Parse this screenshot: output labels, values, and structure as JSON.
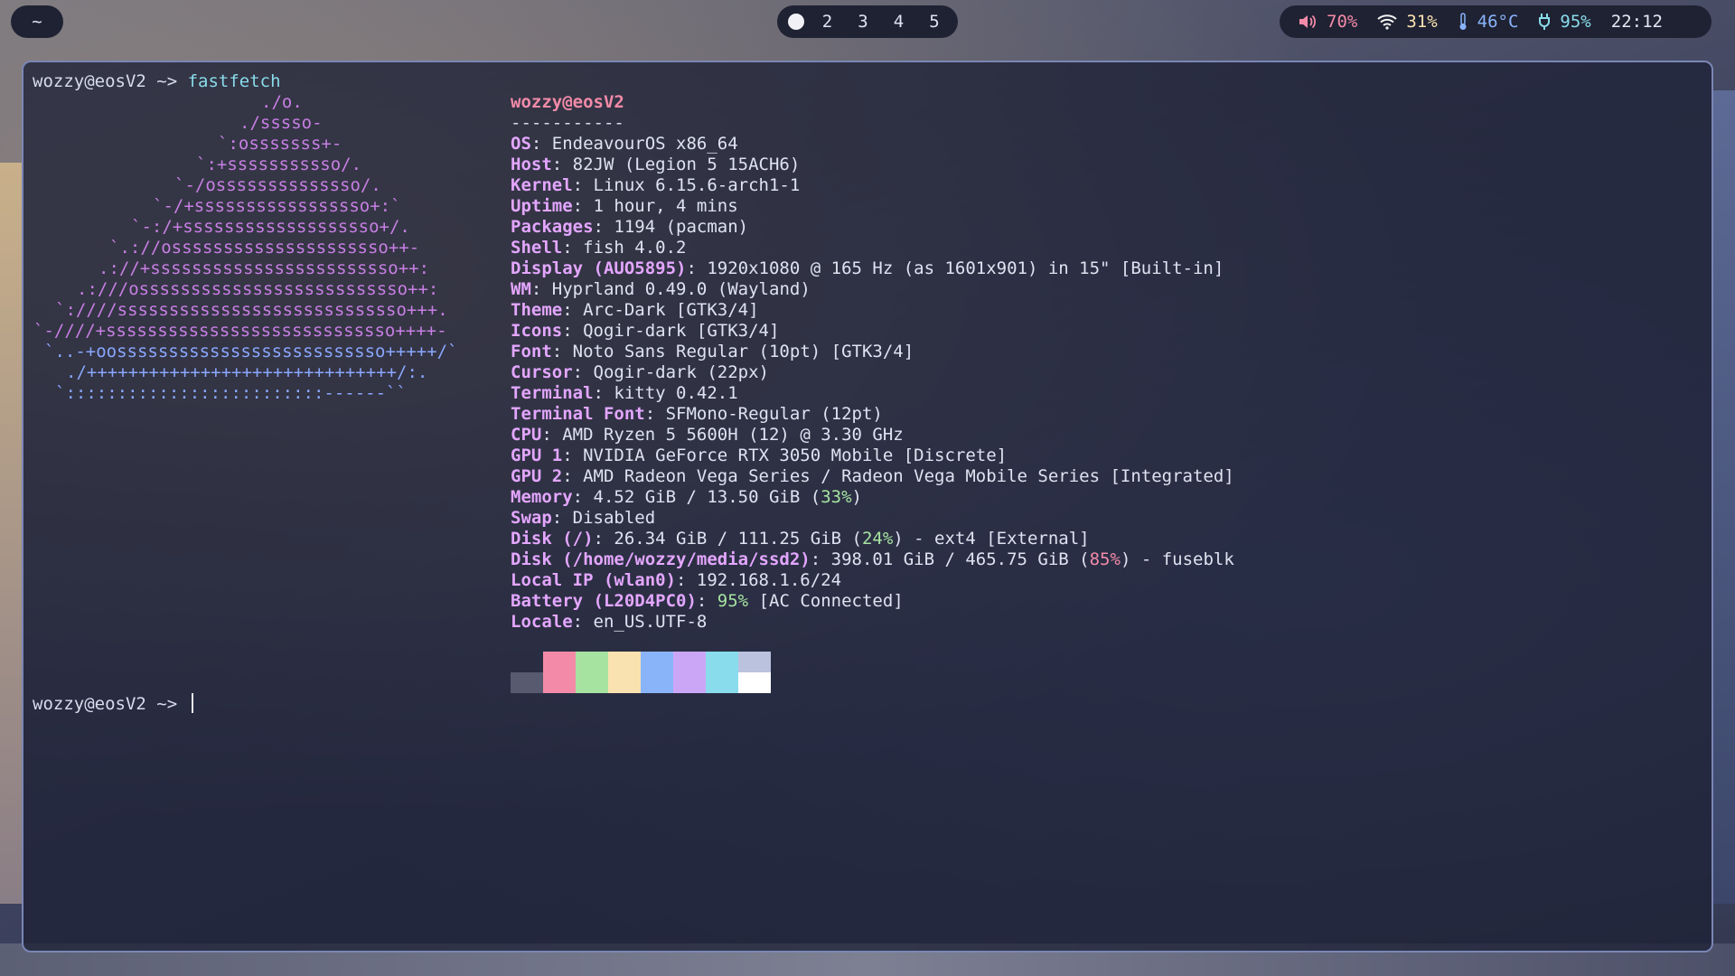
{
  "topbar": {
    "left_label": "~",
    "workspaces": [
      "2",
      "3",
      "4",
      "5"
    ],
    "volume": "70%",
    "wifi": "31%",
    "temperature": "46°C",
    "battery": "95%",
    "clock": "22:12",
    "icons": [
      "speaker-icon",
      "wifi-icon",
      "thermometer-icon",
      "power-plug-icon"
    ]
  },
  "terminal": {
    "prompt": "wozzy@eosV2 ~> ",
    "command": "fastfetch",
    "title_user": "wozzy",
    "title_host": "@eosV2",
    "separator": "-----------",
    "logo_lines": [
      "./o.",
      "./sssso-",
      "`:osssssss+-",
      "`:+sssssssssso/.",
      "`-/ossssssssssssso/.",
      "`-/+sssssssssssssssso+:`",
      "`-:/+sssssssssssssssssso+/.",
      "`.://osssssssssssssssssssso++-",
      ".://+ssssssssssssssssssssssso++:",
      ".:///ossssssssssssssssssssssssso++:",
      "`:////ssssssssssssssssssssssssssso+++.",
      "`-////+ssssssssssssssssssssssssssso++++-",
      "`..-+oossssssssssssssssssssssssso+++++/`",
      "./++++++++++++++++++++++++++++++/:.",
      "`:::::::::::::::::::::::::------``"
    ],
    "info": [
      {
        "key": "OS",
        "value": "EndeavourOS x86_64"
      },
      {
        "key": "Host",
        "value": "82JW (Legion 5 15ACH6)"
      },
      {
        "key": "Kernel",
        "value": "Linux 6.15.6-arch1-1"
      },
      {
        "key": "Uptime",
        "value": "1 hour, 4 mins"
      },
      {
        "key": "Packages",
        "value": "1194 (pacman)"
      },
      {
        "key": "Shell",
        "value": "fish 4.0.2"
      },
      {
        "key": "Display (AUO5895)",
        "value": "1920x1080 @ 165 Hz (as 1601x901) in 15\" [Built-in]"
      },
      {
        "key": "WM",
        "value": "Hyprland 0.49.0 (Wayland)"
      },
      {
        "key": "Theme",
        "value": "Arc-Dark [GTK3/4]"
      },
      {
        "key": "Icons",
        "value": "Qogir-dark [GTK3/4]"
      },
      {
        "key": "Font",
        "value": "Noto Sans Regular (10pt) [GTK3/4]"
      },
      {
        "key": "Cursor",
        "value": "Qogir-dark (22px)"
      },
      {
        "key": "Terminal",
        "value": "kitty 0.42.1"
      },
      {
        "key": "Terminal Font",
        "value": "SFMono-Regular (12pt)"
      },
      {
        "key": "CPU",
        "value": "AMD Ryzen 5 5600H (12) @ 3.30 GHz"
      },
      {
        "key": "GPU 1",
        "value": "NVIDIA GeForce RTX 3050 Mobile [Discrete]"
      },
      {
        "key": "GPU 2",
        "value": "AMD Radeon Vega Series / Radeon Vega Mobile Series [Integrated]"
      },
      {
        "key": "Memory",
        "value_pre": "4.52 GiB / 13.50 GiB (",
        "pct": "33%",
        "pct_color": "green",
        "value_post": ")"
      },
      {
        "key": "Swap",
        "value": "Disabled"
      },
      {
        "key": "Disk (/)",
        "value_pre": "26.34 GiB / 111.25 GiB (",
        "pct": "24%",
        "pct_color": "green",
        "value_post": ") - ext4 [External]"
      },
      {
        "key": "Disk (/home/wozzy/media/ssd2)",
        "value_pre": "398.01 GiB / 465.75 GiB (",
        "pct": "85%",
        "pct_color": "red",
        "value_post": ") - fuseblk"
      },
      {
        "key": "Local IP (wlan0)",
        "value": "192.168.1.6/24"
      },
      {
        "key": "Battery (L20D4PC0)",
        "value_pre": "",
        "pct": "95%",
        "pct_color": "green",
        "value_post": " [AC Connected]"
      },
      {
        "key": "Locale",
        "value": "en_US.UTF-8"
      }
    ],
    "palette_top": [
      "#3b3f51",
      "#f38ba8",
      "#a6e3a1",
      "#f9e2af",
      "#89b4fa",
      "#cba6f7",
      "#89dceb",
      "#bac2de"
    ],
    "palette_bottom": [
      "#585b70",
      "#f38ba8",
      "#a6e3a1",
      "#f9e2af",
      "#89b4fa",
      "#cba6f7",
      "#89dceb",
      "#ffffff"
    ]
  }
}
